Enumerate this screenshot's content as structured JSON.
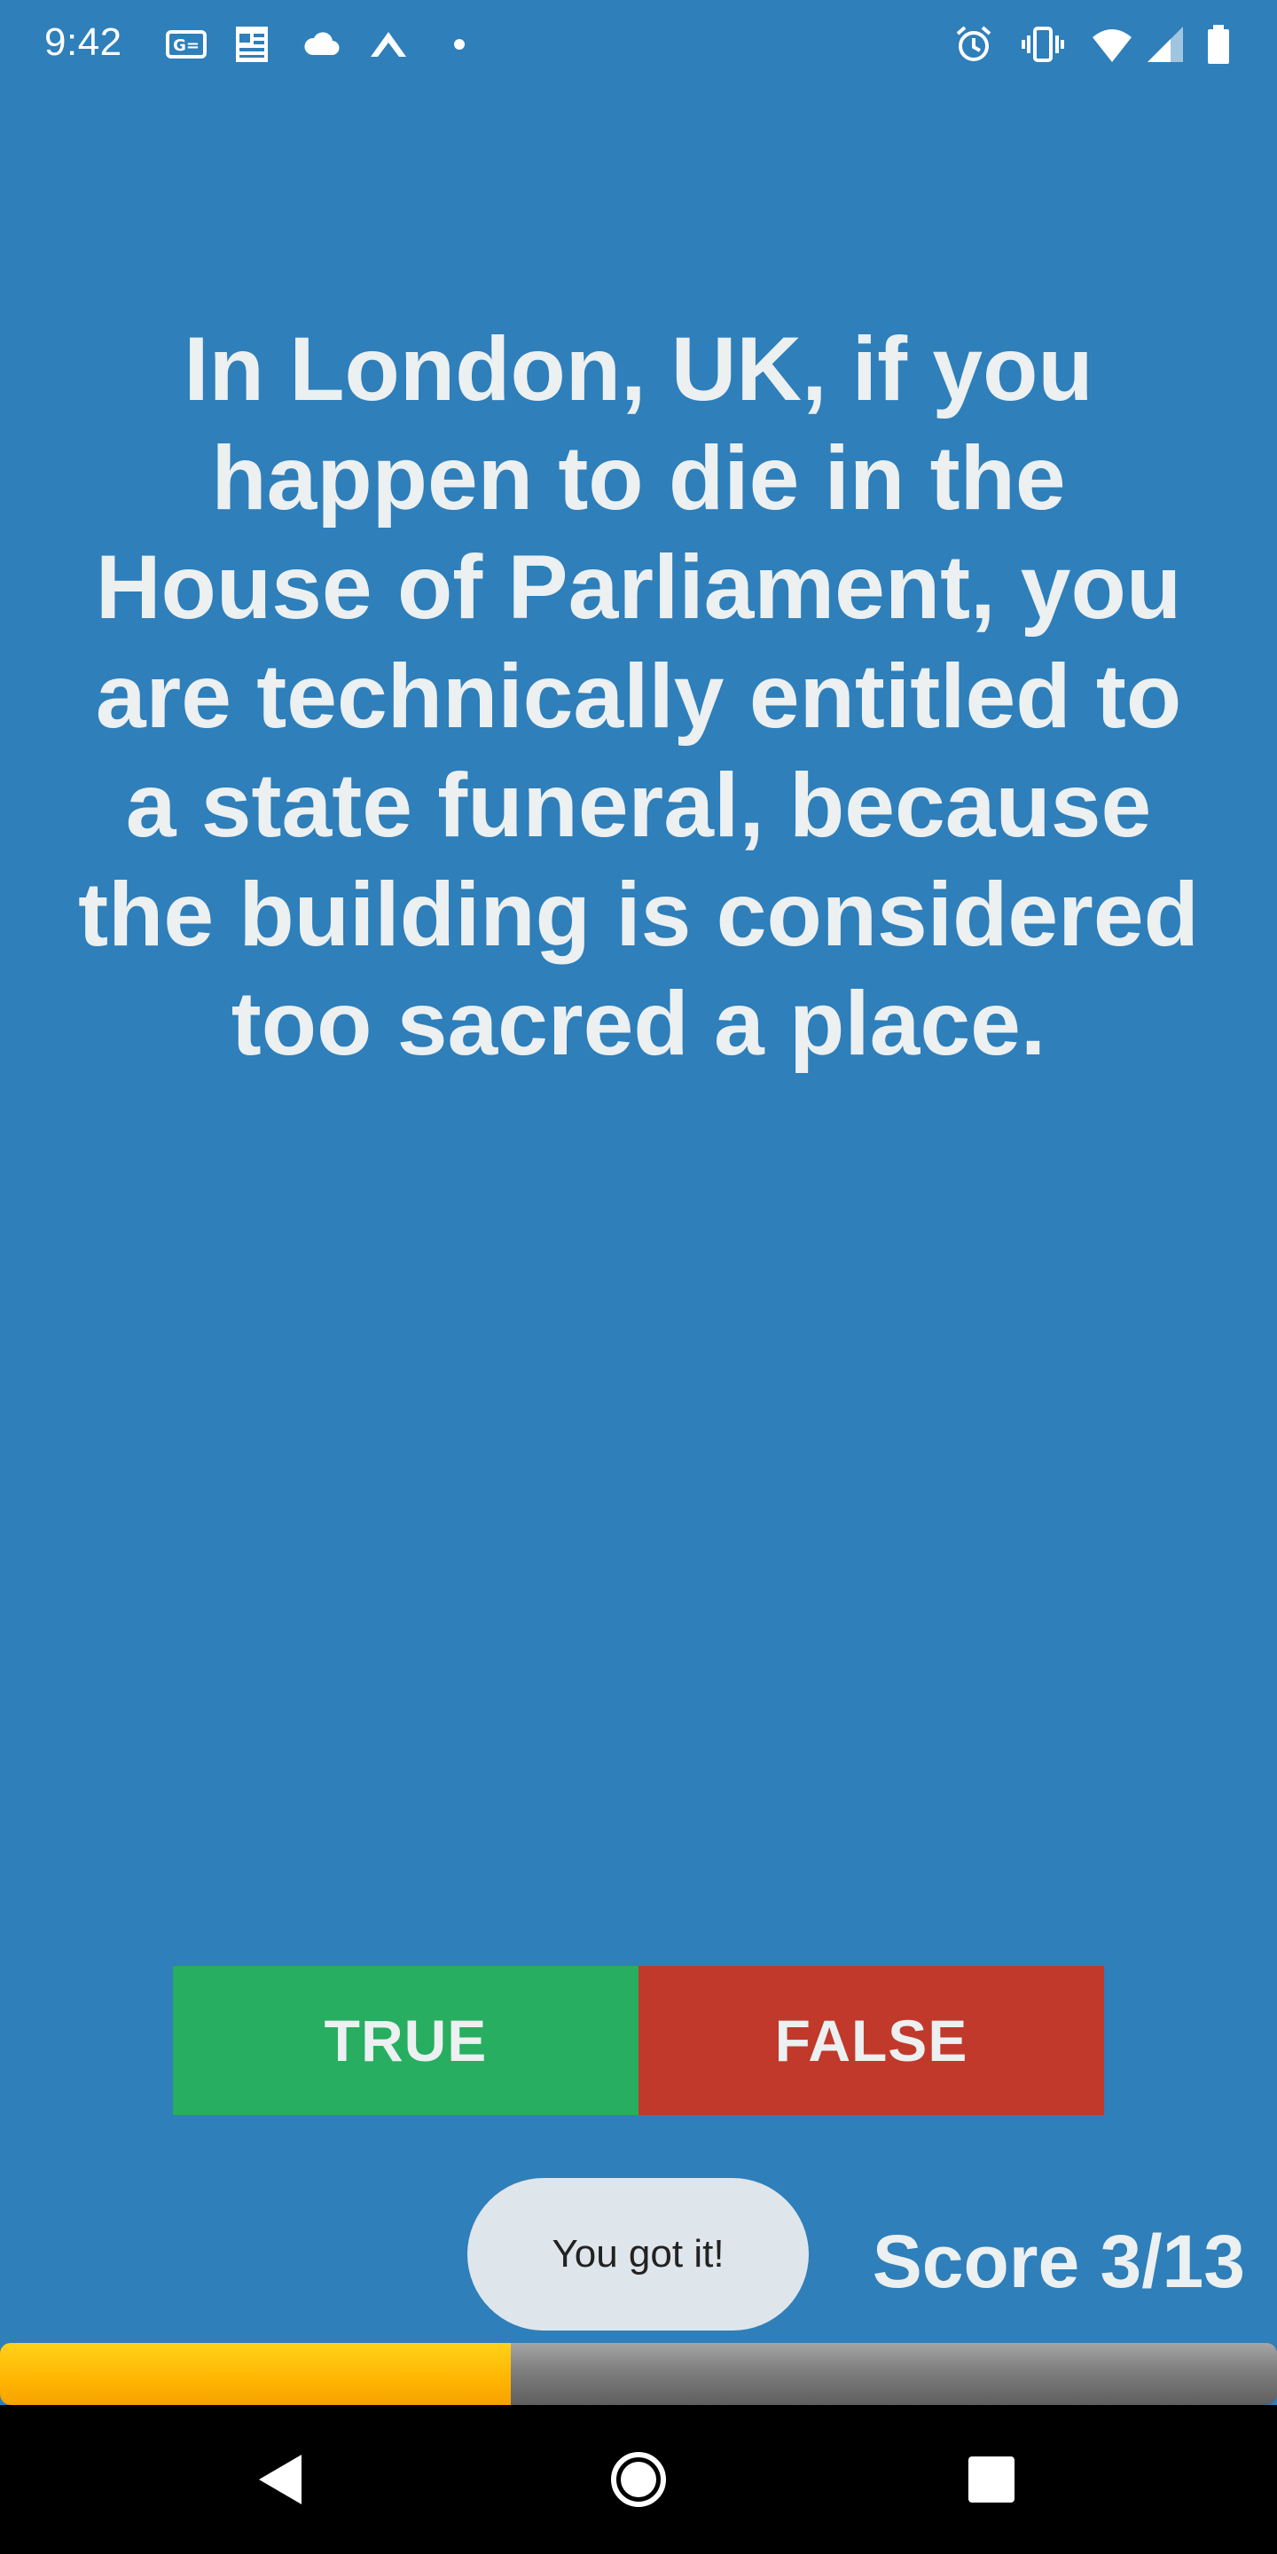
{
  "status_bar": {
    "time": "9:42",
    "left_icons": [
      "news-icon",
      "gallery-icon",
      "cloud-icon",
      "arrow-up-icon",
      "dot-icon"
    ],
    "right_icons": [
      "alarm-icon",
      "vibrate-icon",
      "wifi-icon",
      "cell-signal-icon",
      "battery-icon"
    ]
  },
  "question": {
    "text": "In London, UK, if you happen to die in the House of Parliament, you are technically entitled to a state funeral, because the building is considered too sacred a place."
  },
  "answers": {
    "true_label": "TRUE",
    "false_label": "FALSE"
  },
  "toast": {
    "message": "You got it!"
  },
  "score": {
    "label": "Score 3/13",
    "current": 3,
    "total": 13
  },
  "progress": {
    "fraction": 0.4
  },
  "colors": {
    "background": "#2e7fba",
    "text": "#ecf0f1",
    "true_button": "#27ae60",
    "false_button": "#c0392b",
    "progress_fill": "#ffb400",
    "progress_track": "#7e7e7e",
    "toast_bg": "#dfe6eb"
  },
  "nav_bar": {
    "buttons": [
      "back-icon",
      "home-icon",
      "recents-icon"
    ]
  }
}
